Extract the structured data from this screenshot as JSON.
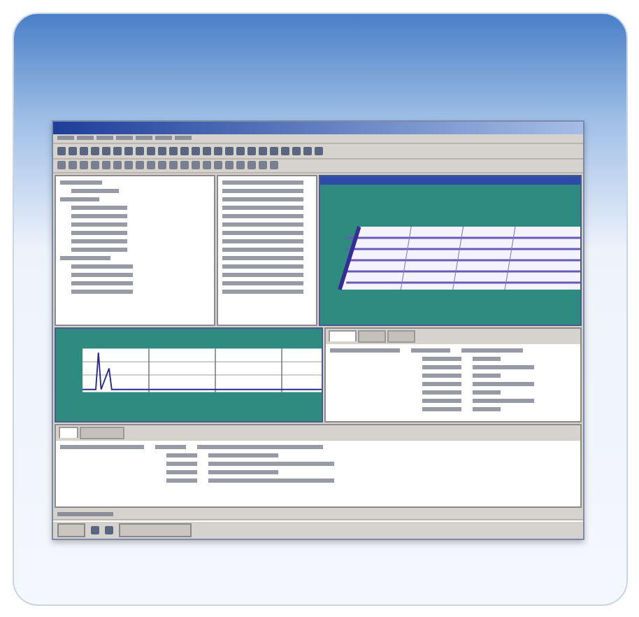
{
  "chart_window": {
    "tabs": [
      {
        "selected": true
      },
      {
        "selected": false
      },
      {
        "selected": false
      }
    ]
  },
  "bottom_pane": {
    "tabs": [
      {
        "selected": true
      },
      {
        "selected": false
      }
    ]
  }
}
